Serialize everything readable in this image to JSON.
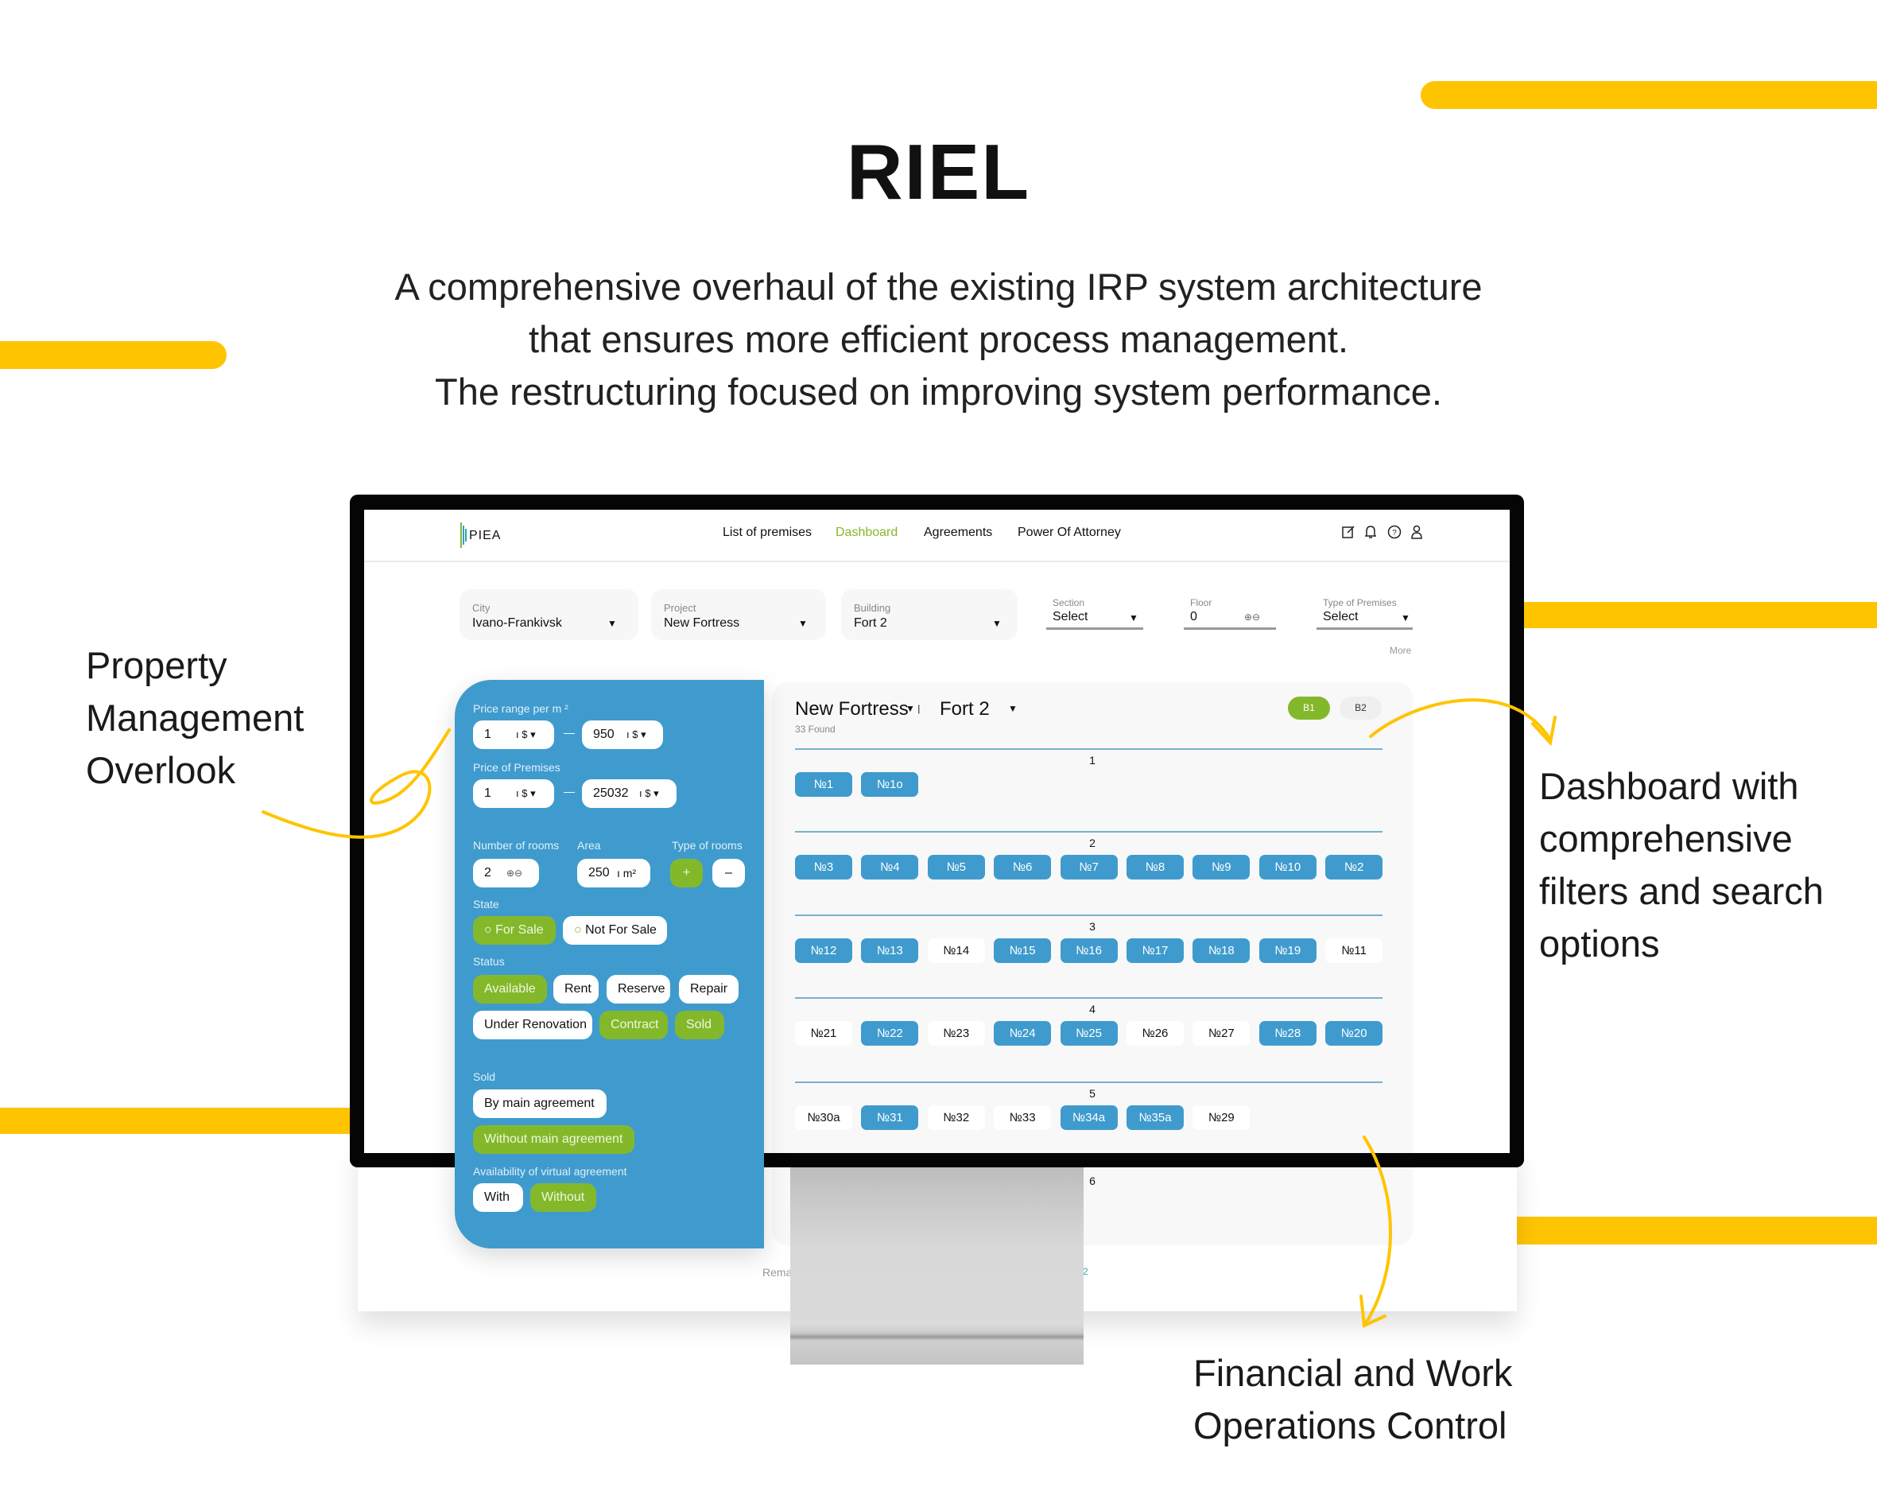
{
  "colors": {
    "accent_yellow": "#FFC400",
    "primary_blue": "#3F9BCD",
    "active_green": "#84B82B"
  },
  "hero": {
    "title": "RIEL",
    "subtitle_lines": [
      "A comprehensive overhaul of the existing IRP system architecture",
      "that ensures more efficient process management.",
      "The restructuring focused on improving system performance."
    ]
  },
  "callouts": {
    "left": [
      "Property",
      "Management",
      "Overlook"
    ],
    "right": [
      "Dashboard with",
      "comprehensive",
      "filters and search",
      "options"
    ],
    "bottom": [
      "Financial and Work",
      "Operations Control"
    ]
  },
  "app": {
    "logo": "PIEA",
    "nav": [
      {
        "label": "List of premises"
      },
      {
        "label": "Dashboard",
        "active": true
      },
      {
        "label": "Agreements"
      },
      {
        "label": "Power Of Attorney"
      }
    ],
    "header_icons": [
      "edit-icon",
      "bell-icon",
      "help-icon",
      "user-icon"
    ],
    "filters": {
      "city": {
        "label": "City",
        "value": "Ivano-Frankivsk"
      },
      "project": {
        "label": "Project",
        "value": "New Fortress"
      },
      "building": {
        "label": "Building",
        "value": "Fort 2"
      },
      "section": {
        "label": "Section",
        "value": "Select"
      },
      "floor": {
        "label": "Floor",
        "value": "0"
      },
      "type": {
        "label": "Type of Premises",
        "value": "Select"
      },
      "more": "More"
    },
    "sidebar": {
      "price_range_label": "Price range per m ²",
      "price_range_from": "1",
      "price_range_to": "950",
      "currency": "$",
      "price_premises_label": "Price of Premises",
      "price_premises_from": "1",
      "price_premises_to": "25032",
      "rooms_label": "Number of rooms",
      "rooms_value": "2",
      "area_label": "Area",
      "area_value": "250",
      "area_unit": "m²",
      "type_rooms_label": "Type of rooms",
      "plus": "+",
      "minus": "–",
      "state_label": "State",
      "state_options": [
        "For Sale",
        "Not For Sale"
      ],
      "status_label": "Status",
      "status_options": [
        "Available",
        "Rent",
        "Reserve",
        "Repair",
        "Under Renovation",
        "Contract",
        "Sold"
      ],
      "sold_label": "Sold",
      "sold_options": [
        "By main agreement",
        "Without main agreement"
      ],
      "virtual_label": "Availability of virtual agreement",
      "virtual_options": [
        "With",
        "Without"
      ]
    },
    "main": {
      "project": "New Fortress",
      "building": "Fort 2",
      "found": "33 Found",
      "sections": [
        "B1",
        "B2"
      ],
      "active_section": "B1",
      "floors": [
        {
          "number": "1",
          "units": [
            {
              "label": "№1",
              "state": "b"
            },
            {
              "label": "№1o",
              "state": "b"
            }
          ]
        },
        {
          "number": "2",
          "units": [
            {
              "label": "№3",
              "state": "b"
            },
            {
              "label": "№4",
              "state": "b"
            },
            {
              "label": "№5",
              "state": "b"
            },
            {
              "label": "№6",
              "state": "b"
            },
            {
              "label": "№7",
              "state": "b"
            },
            {
              "label": "№8",
              "state": "b"
            },
            {
              "label": "№9",
              "state": "b"
            },
            {
              "label": "№10",
              "state": "b"
            },
            {
              "label": "№2",
              "state": "b"
            }
          ]
        },
        {
          "number": "3",
          "units": [
            {
              "label": "№12",
              "state": "b"
            },
            {
              "label": "№13",
              "state": "b"
            },
            {
              "label": "№14",
              "state": "w"
            },
            {
              "label": "№15",
              "state": "b"
            },
            {
              "label": "№16",
              "state": "b"
            },
            {
              "label": "№17",
              "state": "b"
            },
            {
              "label": "№18",
              "state": "b"
            },
            {
              "label": "№19",
              "state": "b"
            },
            {
              "label": "№11",
              "state": "w"
            }
          ]
        },
        {
          "number": "4",
          "units": [
            {
              "label": "№21",
              "state": "w"
            },
            {
              "label": "№22",
              "state": "b"
            },
            {
              "label": "№23",
              "state": "w"
            },
            {
              "label": "№24",
              "state": "b"
            },
            {
              "label": "№25",
              "state": "b"
            },
            {
              "label": "№26",
              "state": "w"
            },
            {
              "label": "№27",
              "state": "w"
            },
            {
              "label": "№28",
              "state": "b"
            },
            {
              "label": "№20",
              "state": "b"
            }
          ]
        },
        {
          "number": "5",
          "units": [
            {
              "label": "№30a",
              "state": "w"
            },
            {
              "label": "№31",
              "state": "b"
            },
            {
              "label": "№32",
              "state": "w"
            },
            {
              "label": "№33",
              "state": "w"
            },
            {
              "label": "№34a",
              "state": "b"
            },
            {
              "label": "№35a",
              "state": "b"
            },
            {
              "label": "№29",
              "state": "w"
            }
          ]
        },
        {
          "number": "6",
          "units": []
        }
      ],
      "footer_left": "Rema",
      "footer_right": "2"
    }
  }
}
